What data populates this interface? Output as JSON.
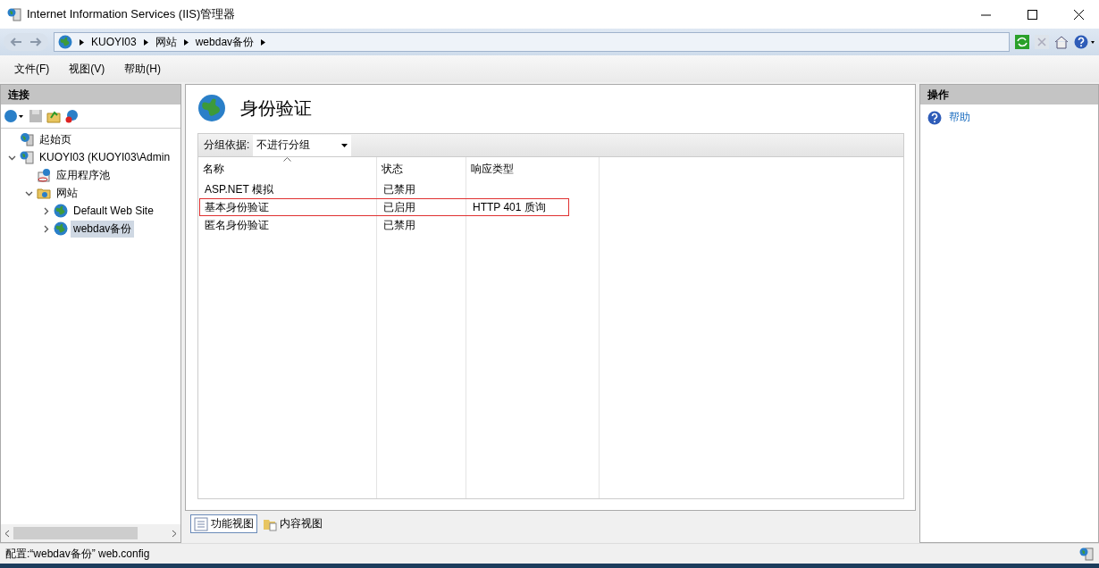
{
  "window": {
    "title": "Internet Information Services (IIS)管理器"
  },
  "address": {
    "crumbs": [
      "KUOYI03",
      "网站",
      "webdav备份"
    ]
  },
  "menu": [
    "文件(F)",
    "视图(V)",
    "帮助(H)"
  ],
  "connections": {
    "title": "连接",
    "tree": [
      {
        "label": "起始页",
        "kind": "home",
        "selected": false
      },
      {
        "label": "KUOYI03 (KUOYI03\\Admin",
        "kind": "server",
        "selected": false,
        "expanded": true,
        "children": [
          {
            "label": "应用程序池",
            "kind": "pool",
            "selected": false
          },
          {
            "label": "网站",
            "kind": "folder",
            "selected": false,
            "expanded": true,
            "children": [
              {
                "label": "Default Web Site",
                "kind": "site",
                "selected": false,
                "expanded": false
              },
              {
                "label": "webdav备份",
                "kind": "site",
                "selected": true,
                "expanded": false
              }
            ]
          }
        ]
      }
    ]
  },
  "feature": {
    "title": "身份验证",
    "group_by_label": "分组依据:",
    "group_by_value": "不进行分组",
    "table": {
      "columns": [
        "名称",
        "状态",
        "响应类型"
      ],
      "rows": [
        {
          "cells": [
            "ASP.NET 模拟",
            "已禁用",
            ""
          ],
          "marked": false
        },
        {
          "cells": [
            "基本身份验证",
            "已启用",
            "HTTP 401 质询"
          ],
          "marked": true
        },
        {
          "cells": [
            "匿名身份验证",
            "已禁用",
            ""
          ],
          "marked": false
        }
      ]
    },
    "views": [
      {
        "label": "功能视图",
        "selected": true
      },
      {
        "label": "内容视图",
        "selected": false
      }
    ]
  },
  "actions": {
    "title": "操作",
    "items": [
      "帮助"
    ]
  },
  "status_bar": "配置:“webdav备份” web.config"
}
